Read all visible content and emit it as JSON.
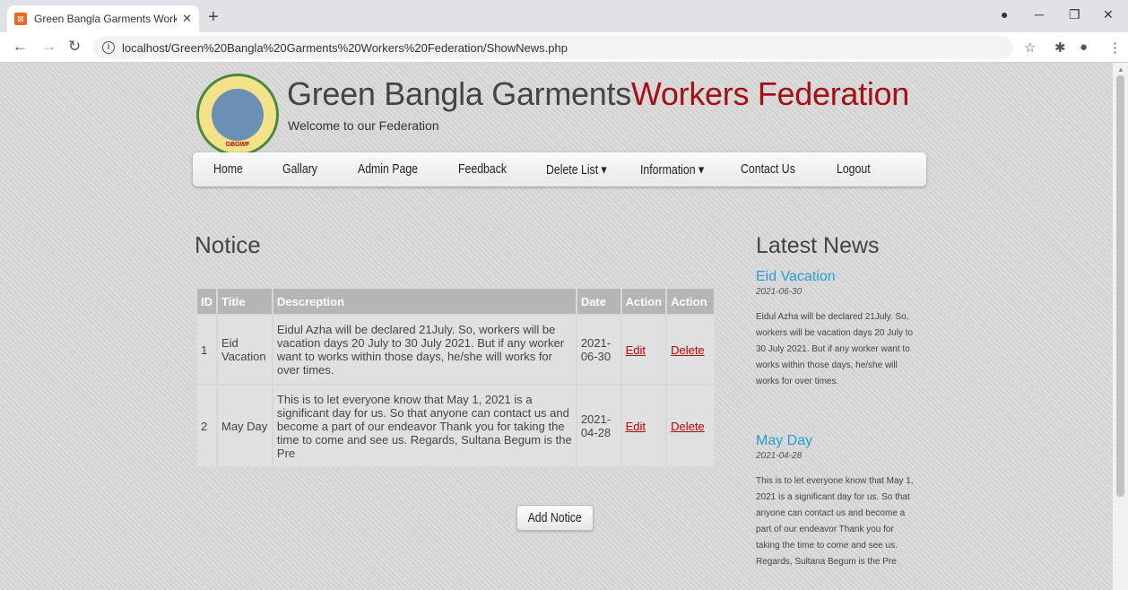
{
  "browser": {
    "tab_title": "Green Bangla Garments Workers",
    "url": "localhost/Green%20Bangla%20Garments%20Workers%20Federation/ShowNews.php"
  },
  "site": {
    "title_part1": "Green Bangla Garments",
    "title_part2": "Workers Federation",
    "tagline": "Welcome to our Federation",
    "logo_abbr": "GBGWF"
  },
  "nav": {
    "items": [
      "Home",
      "Gallary",
      "Admin Page",
      "Feedback",
      "Delete List",
      "Information",
      "Contact Us",
      "Logout"
    ],
    "dropdown_caret": "▾"
  },
  "notice": {
    "heading": "Notice",
    "columns": [
      "ID",
      "Title",
      "Descreption",
      "Date",
      "Action",
      "Action"
    ],
    "rows": [
      {
        "id": "1",
        "title": "Eid Vacation",
        "description": "Eidul Azha will be declared 21July. So, workers will be vacation days 20 July to 30 July 2021. But if any worker want to works within those days, he/she will works for over times.",
        "date": "2021-06-30",
        "edit": "Edit",
        "delete": "Delete"
      },
      {
        "id": "2",
        "title": "May Day",
        "description": "This is to let everyone know that May 1, 2021 is a significant day for us. So that anyone can contact us and become a part of our endeavor Thank you for taking the time to come and see us. Regards, Sultana Begum is the Pre",
        "date": "2021-04-28",
        "edit": "Edit",
        "delete": "Delete"
      }
    ],
    "add_button": "Add Notice"
  },
  "news": {
    "heading": "Latest News",
    "items": [
      {
        "title": "Eid Vacation",
        "date": "2021-06-30",
        "body": "Eidul Azha will be declared 21July. So, workers will be vacation days 20 July to 30 July 2021. But if any worker want to works within those days, he/she will works for over times."
      },
      {
        "title": "May Day",
        "date": "2021-04-28",
        "body": "This is to let everyone know that May 1, 2021 is a significant day for us. So that anyone can contact us and become a part of our endeavor Thank you for taking the time to come and see us. Regards, Sultana Begum is the Pre"
      }
    ]
  },
  "colors": {
    "title_red": "#a30f12",
    "news_blue": "#2a9dd6",
    "link_red": "#b00000"
  }
}
